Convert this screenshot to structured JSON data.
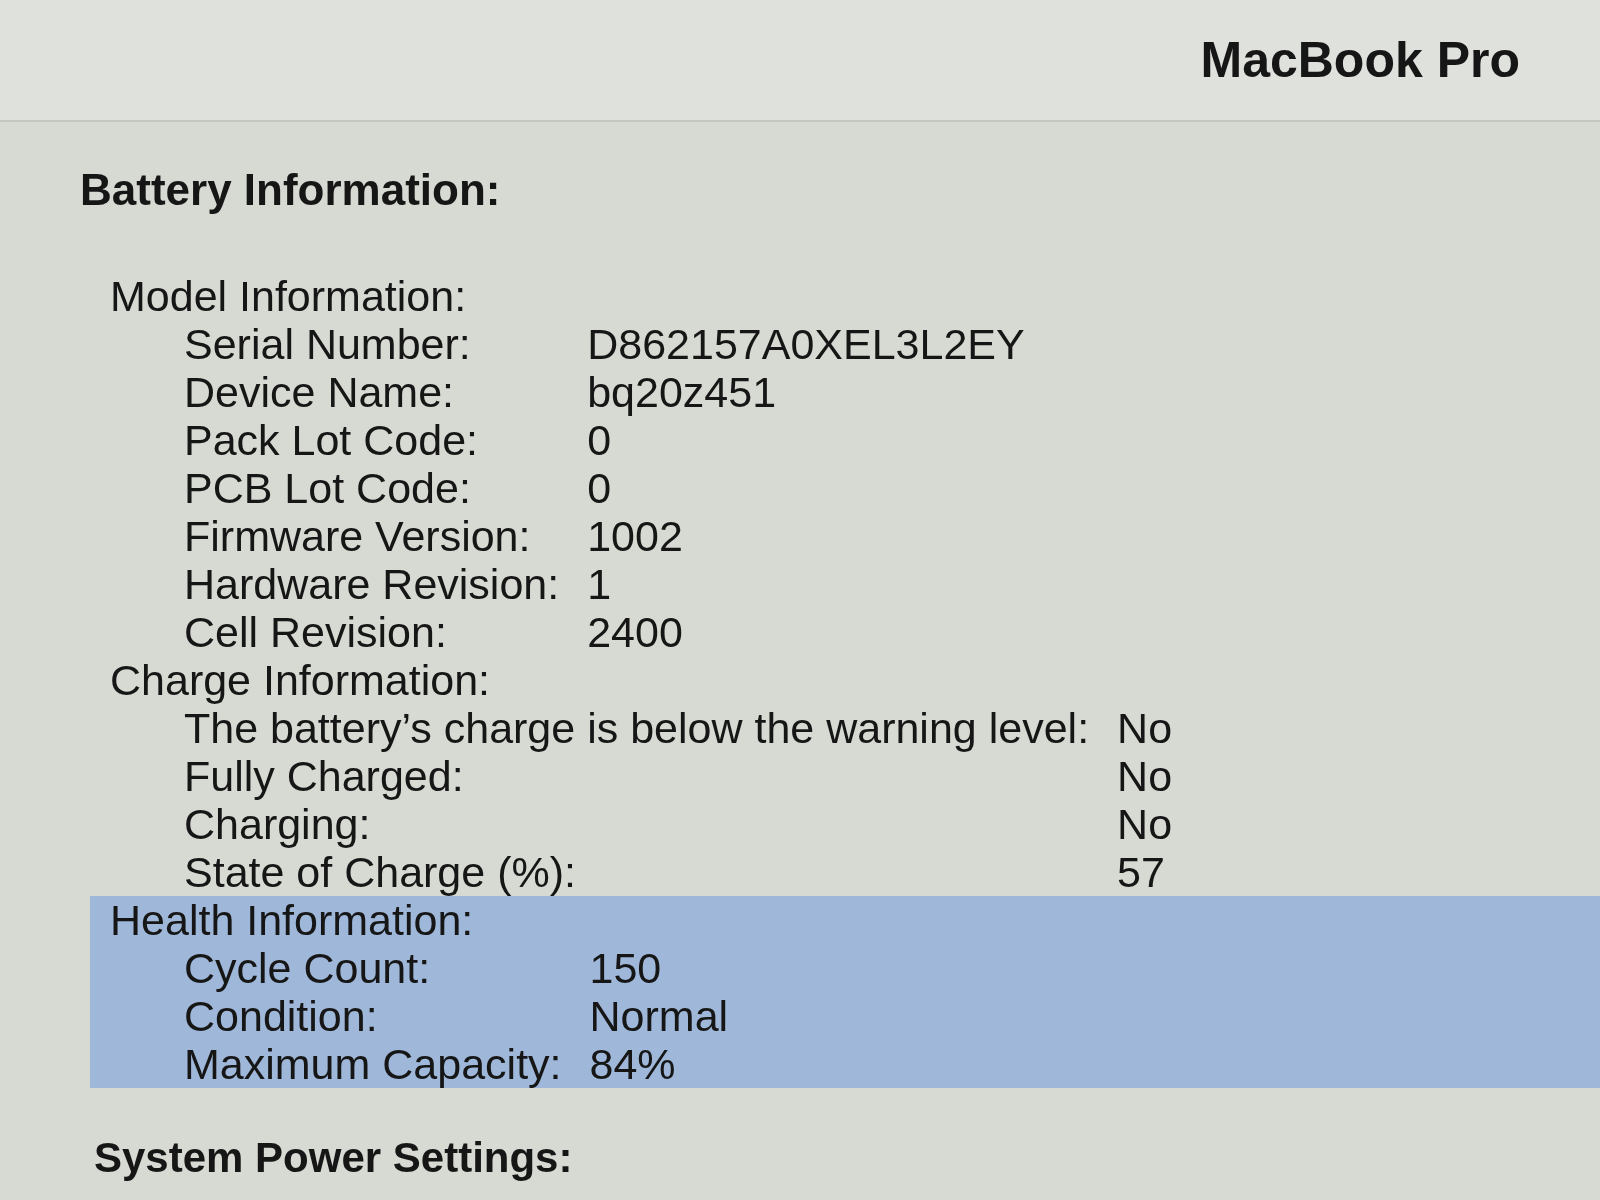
{
  "header": {
    "title": "MacBook Pro"
  },
  "section": {
    "title": "Battery Information:",
    "groups": [
      {
        "title": "Model Information:",
        "selected": false,
        "rows": [
          {
            "label": "Serial Number:",
            "value": "D862157A0XEL3L2EY"
          },
          {
            "label": "Device Name:",
            "value": "bq20z451"
          },
          {
            "label": "Pack Lot Code:",
            "value": "0"
          },
          {
            "label": "PCB Lot Code:",
            "value": "0"
          },
          {
            "label": "Firmware Version:",
            "value": "1002"
          },
          {
            "label": "Hardware Revision:",
            "value": "1"
          },
          {
            "label": "Cell Revision:",
            "value": "2400"
          }
        ]
      },
      {
        "title": "Charge Information:",
        "selected": false,
        "rows": [
          {
            "label": "The battery’s charge is below the warning level:",
            "value": "No"
          },
          {
            "label": "Fully Charged:",
            "value": "No"
          },
          {
            "label": "Charging:",
            "value": "No"
          },
          {
            "label": "State of Charge (%):",
            "value": "57"
          }
        ]
      },
      {
        "title": "Health Information:",
        "selected": true,
        "rows": [
          {
            "label": "Cycle Count:",
            "value": "150"
          },
          {
            "label": "Condition:",
            "value": "Normal"
          },
          {
            "label": "Maximum Capacity:",
            "value": "84%"
          }
        ]
      }
    ]
  },
  "next_section": {
    "title": "System Power Settings:"
  }
}
